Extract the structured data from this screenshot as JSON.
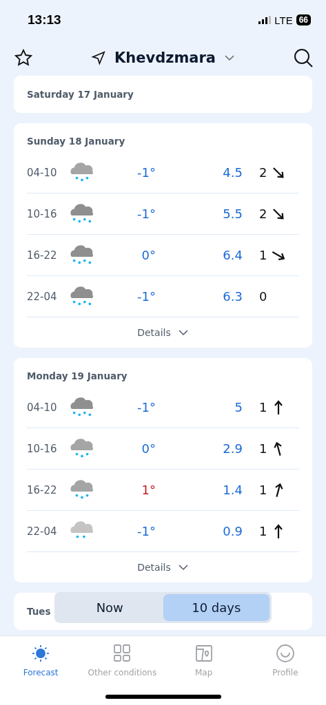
{
  "status_bar": {
    "time": "13:13",
    "network": "LTE",
    "battery": "66"
  },
  "header": {
    "location": "Khevdzmara"
  },
  "days": [
    {
      "title": "Saturday 17 January",
      "expanded": false
    },
    {
      "title": "Sunday 18 January",
      "expanded": true,
      "details": "Details",
      "rows": [
        {
          "period": "04-10",
          "snow": {
            "kind": "moderate"
          },
          "temp": "-1°",
          "warm": false,
          "amount": "4.5",
          "wind": "2",
          "arrow": {
            "kind": "southeast"
          }
        },
        {
          "period": "10-16",
          "snow": {
            "kind": "heavy"
          },
          "temp": "-1°",
          "warm": false,
          "amount": "5.5",
          "wind": "2",
          "arrow": {
            "kind": "southeast"
          }
        },
        {
          "period": "16-22",
          "snow": {
            "kind": "heavy"
          },
          "temp": "0°",
          "warm": false,
          "amount": "6.4",
          "wind": "1",
          "arrow": {
            "kind": "eastsoutheast"
          }
        },
        {
          "period": "22-04",
          "snow": {
            "kind": "heavy"
          },
          "temp": "-1°",
          "warm": false,
          "amount": "6.3",
          "wind": "0"
        }
      ]
    },
    {
      "title": "Monday 19 January",
      "expanded": true,
      "details": "Details",
      "rows": [
        {
          "period": "04-10",
          "snow": {
            "kind": "heavy"
          },
          "temp": "-1°",
          "warm": false,
          "amount": "5",
          "wind": "1",
          "arrow": {
            "kind": "north"
          }
        },
        {
          "period": "10-16",
          "snow": {
            "kind": "moderate"
          },
          "temp": "0°",
          "warm": false,
          "amount": "2.9",
          "wind": "1",
          "arrow": {
            "kind": "northnorthwest"
          }
        },
        {
          "period": "16-22",
          "snow": {
            "kind": "moderate"
          },
          "temp": "1°",
          "warm": true,
          "amount": "1.4",
          "wind": "1",
          "arrow": {
            "kind": "northnortheast"
          }
        },
        {
          "period": "22-04",
          "snow": {
            "kind": "light"
          },
          "temp": "-1°",
          "warm": false,
          "amount": "0.9",
          "wind": "1",
          "arrow": {
            "kind": "north"
          }
        }
      ]
    },
    {
      "title": "Tues",
      "expanded": false
    }
  ],
  "toggle": [
    {
      "label": "Now",
      "selected": false
    },
    {
      "label": "10 days",
      "selected": true
    }
  ],
  "tabs": [
    {
      "label": "Forecast",
      "kind": "sun",
      "selected": true
    },
    {
      "label": "Other conditions",
      "kind": "grid",
      "selected": false
    },
    {
      "label": "Map",
      "kind": "map",
      "selected": false
    },
    {
      "label": "Profile",
      "kind": "smile",
      "selected": false
    }
  ]
}
